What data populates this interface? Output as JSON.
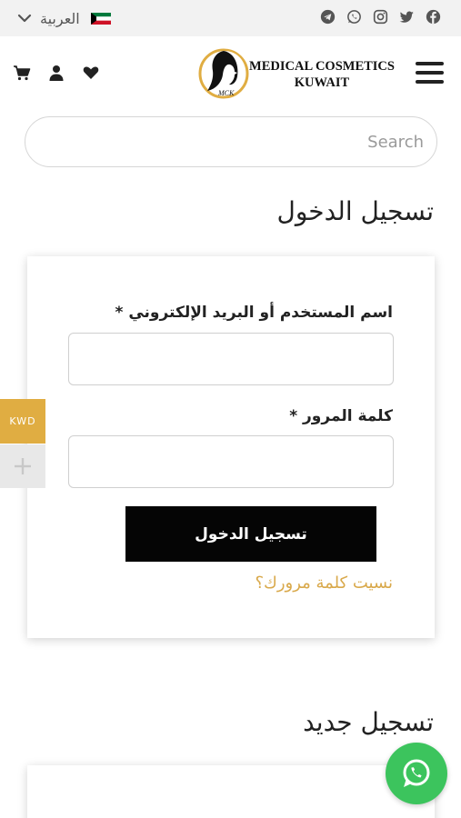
{
  "topbar": {
    "language_label": "العربية",
    "language_icon": "chevron-down-icon",
    "flag": "kuwait-flag",
    "social_icons": [
      "facebook-icon",
      "twitter-icon",
      "instagram-icon",
      "whatsapp-icon",
      "telegram-icon"
    ]
  },
  "header": {
    "logo_line1": "MEDICAL COSMETICS",
    "logo_line2": "KUWAIT",
    "logo_monogram": "MCK",
    "icons": [
      "cart-icon",
      "user-icon",
      "heart-icon",
      "hamburger-menu-icon"
    ]
  },
  "search": {
    "placeholder": "Search",
    "value": ""
  },
  "login": {
    "heading": "تسجيل الدخول",
    "username_label": "اسم المستخدم أو البريد الإلكتروني *",
    "password_label": "كلمة المرور *",
    "submit_label": "تسجيل الدخول",
    "forgot_label": "نسيت كلمة مرورك؟"
  },
  "register": {
    "heading": "تسجيل جديد"
  },
  "currency": {
    "code": "KWD"
  },
  "colors": {
    "accent": "#e0ad42",
    "link": "#d9a94b",
    "button": "#050505",
    "whatsapp": "#3cc45d"
  }
}
